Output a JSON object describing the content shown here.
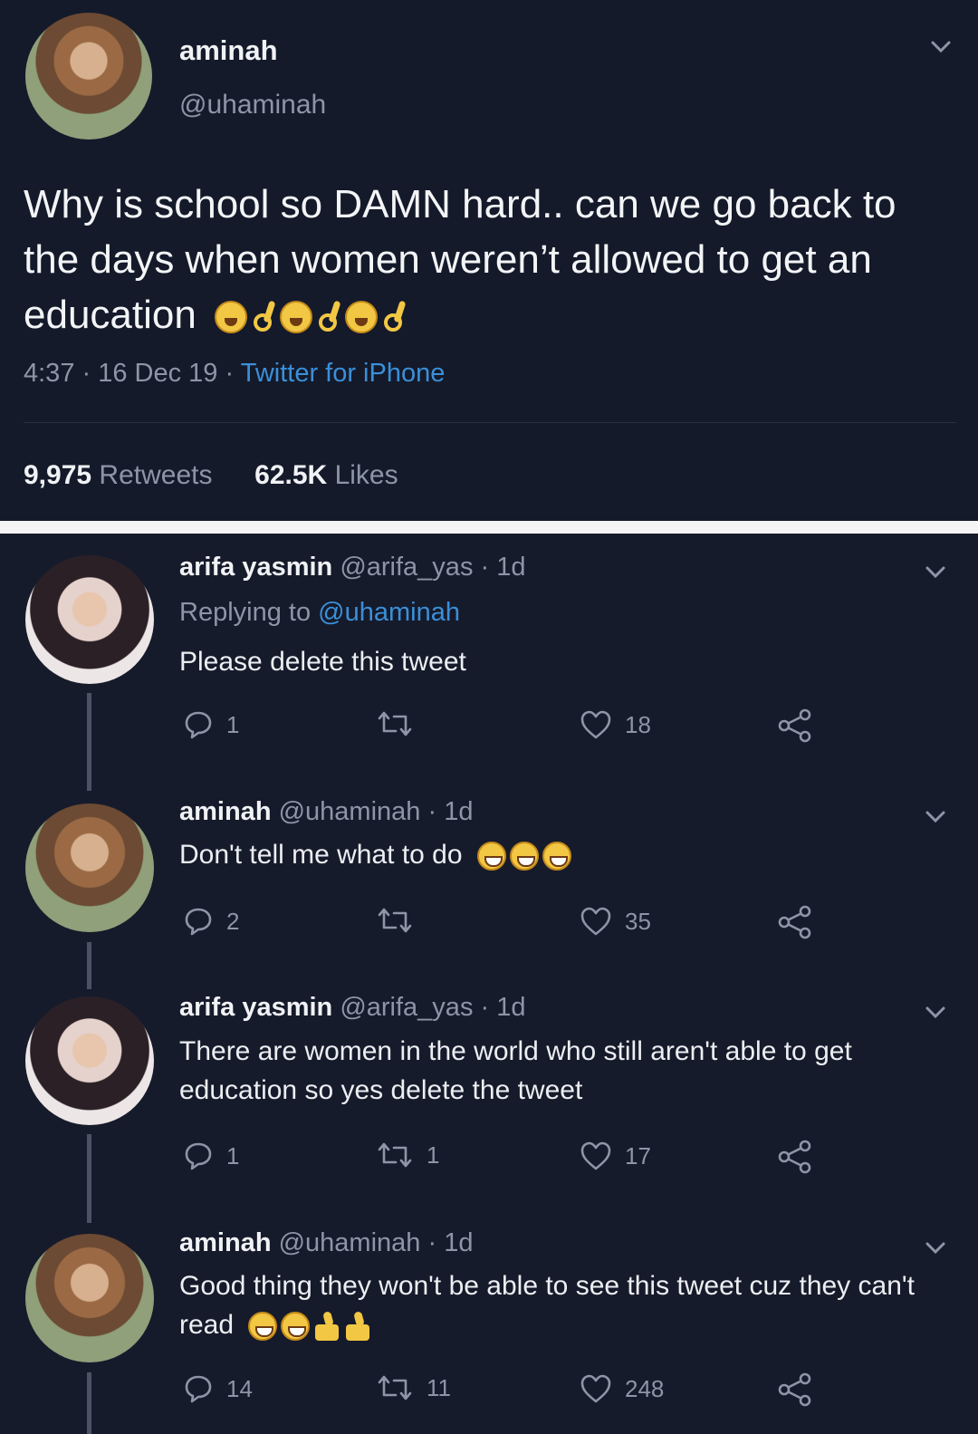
{
  "main_tweet": {
    "name": "aminah",
    "handle": "@uhaminah",
    "text": "Why is school so DAMN hard.. can we go back to the days when women weren’t allowed to get an education",
    "emojis": [
      "weary-face-emoji",
      "ok-hand-emoji",
      "weary-face-emoji",
      "ok-hand-emoji",
      "weary-face-emoji",
      "ok-hand-emoji"
    ],
    "time": "4:37",
    "date": "16 Dec 19",
    "source": "Twitter for iPhone",
    "retweets_count": "9,975",
    "retweets_label": "Retweets",
    "likes_count": "62.5K",
    "likes_label": "Likes"
  },
  "replies": [
    {
      "name": "arifa yasmin",
      "handle": "@arifa_yas",
      "time": "1d",
      "replying_prefix": "Replying to",
      "replying_handle": "@uhaminah",
      "text": "Please delete this tweet",
      "reply_count": "1",
      "retweet_count": "",
      "like_count": "18"
    },
    {
      "name": "aminah",
      "handle": "@uhaminah",
      "time": "1d",
      "text": "Don't tell me what to do",
      "emojis": [
        "tears-of-joy-emoji",
        "tears-of-joy-emoji",
        "tears-of-joy-emoji"
      ],
      "reply_count": "2",
      "retweet_count": "",
      "like_count": "35"
    },
    {
      "name": "arifa yasmin",
      "handle": "@arifa_yas",
      "time": "1d",
      "text": "There are women in the world who still aren't able to get education so yes delete the tweet",
      "reply_count": "1",
      "retweet_count": "1",
      "like_count": "17"
    },
    {
      "name": "aminah",
      "handle": "@uhaminah",
      "time": "1d",
      "text": "Good thing they won't be able to see this tweet cuz they can't read",
      "emojis": [
        "tears-of-joy-emoji",
        "tears-of-joy-emoji",
        "thumbs-up-emoji",
        "thumbs-up-emoji"
      ],
      "reply_count": "14",
      "retweet_count": "11",
      "like_count": "248"
    }
  ],
  "colors": {
    "background": "#161b2b",
    "link": "#3b8fd9",
    "muted": "#8d95a6",
    "text": "#eceef2"
  }
}
